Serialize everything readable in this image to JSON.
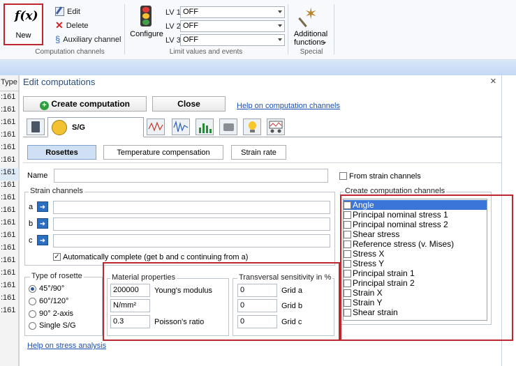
{
  "ribbon": {
    "new_label": "New",
    "edit_label": "Edit",
    "delete_label": "Delete",
    "auxiliary_label": "Auxiliary channel",
    "group_computation": "Computation channels",
    "configure_label": "Configure",
    "lv1_label": "LV 1",
    "lv2_label": "LV 2",
    "lv3_label": "LV 3",
    "lv1_value": "OFF",
    "lv2_value": "OFF",
    "lv3_value": "OFF",
    "group_limits": "Limit values and events",
    "additional_line1": "Additional",
    "additional_line2": "functions",
    "group_special": "Special"
  },
  "left_strip": {
    "header": "Type",
    "items": [
      ":161",
      ":161",
      ":161",
      ":161",
      ":161",
      ":161",
      ":161",
      ":161",
      ":161",
      ":161",
      ":161",
      ":161",
      ":161",
      ":161",
      ":161",
      ":161",
      ":161",
      ":161",
      ":161"
    ]
  },
  "dialog": {
    "title": "Edit computations",
    "close_x": "×",
    "create_label": "Create computation",
    "close_label": "Close",
    "help_channels": "Help on computation channels",
    "active_tab_label": "S/G",
    "subtabs": {
      "rosettes": "Rosettes",
      "temperature": "Temperature compensation",
      "strain_rate": "Strain rate"
    },
    "name_label": "Name",
    "from_strain_label": "From strain channels",
    "strain_legend": "Strain channels",
    "channel_a": "a",
    "channel_b": "b",
    "channel_c": "c",
    "auto_complete": "Automatically complete (get b and c continuing from a)",
    "rosette_legend": "Type of rosette",
    "rosettes": [
      "45°/90°",
      "60°/120°",
      "90° 2-axis",
      "Single S/G"
    ],
    "material_legend": "Material properties",
    "youngs_value": "200000",
    "youngs_label": "Young's modulus",
    "unit_value": "N/mm²",
    "poisson_value": "0.3",
    "poisson_label": "Poisson's ratio",
    "transversal_legend": "Transversal sensitivity in %",
    "grid_a_value": "0",
    "grid_a_label": "Grid a",
    "grid_b_value": "0",
    "grid_b_label": "Grid b",
    "grid_c_value": "0",
    "grid_c_label": "Grid c",
    "channels_legend": "Create computation channels",
    "channels": [
      "Angle",
      "Principal nominal stress 1",
      "Principal nominal stress 2",
      "Shear stress",
      "Reference stress (v. Mises)",
      "Stress X",
      "Stress Y",
      "Principal strain 1",
      "Principal strain 2",
      "Strain X",
      "Strain Y",
      "Shear strain"
    ],
    "help_stress": "Help on stress analysis"
  },
  "colors": {
    "highlight_border": "#c0262d",
    "selection": "#3b75d8",
    "link": "#1a4fb5"
  }
}
